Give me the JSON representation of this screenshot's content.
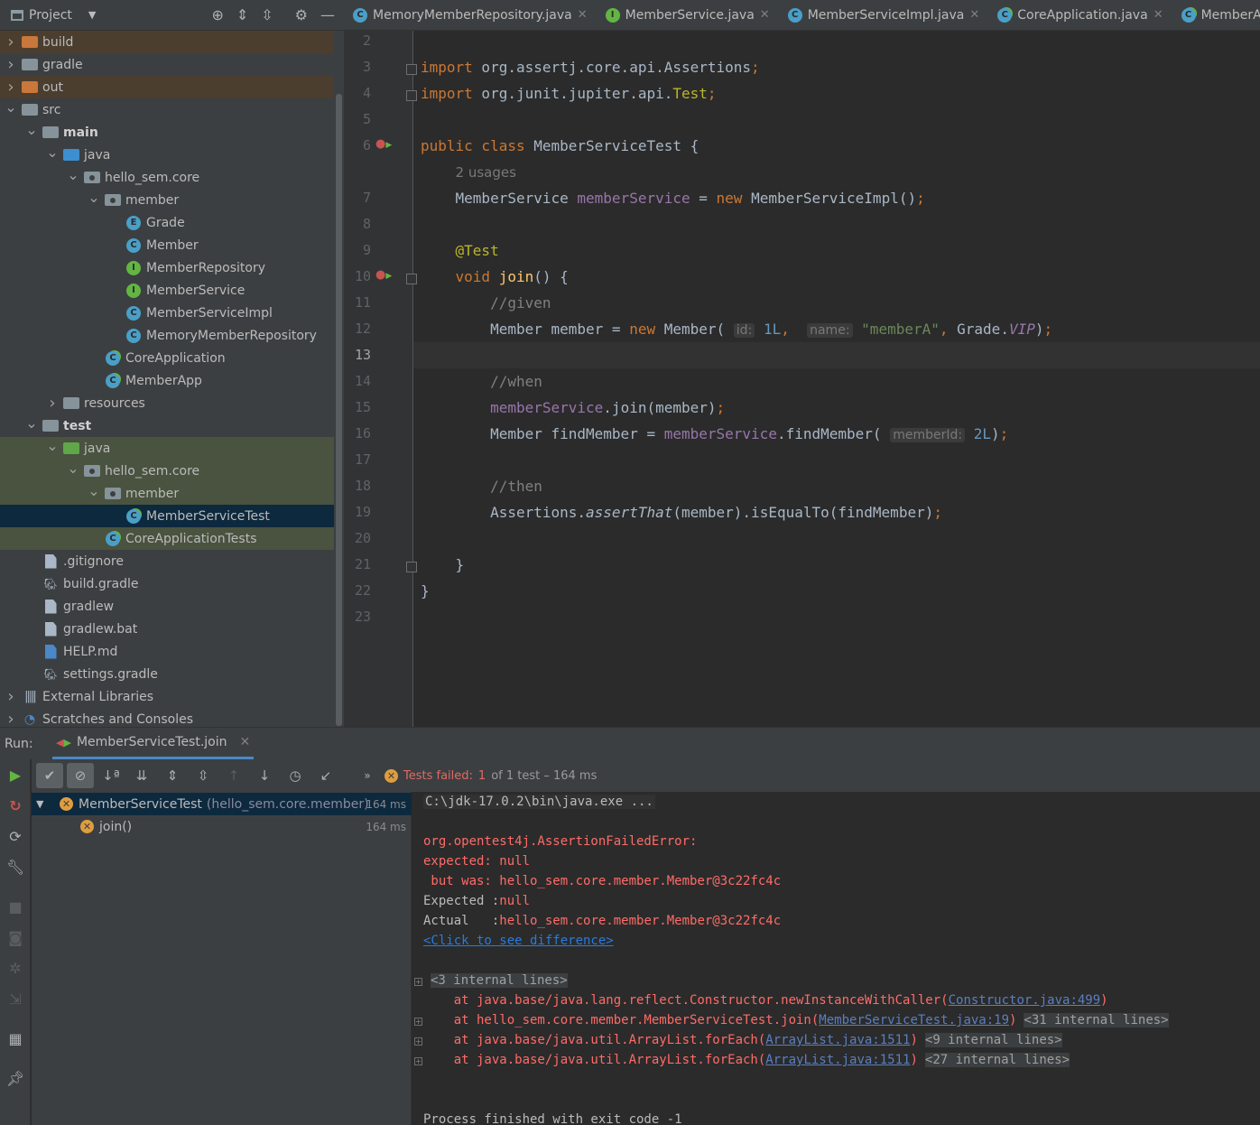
{
  "project_panel": {
    "title": "Project",
    "tree": [
      {
        "label": "build",
        "icon": "folder-orange-icon",
        "arrow": "right",
        "indent": 0,
        "style": "excluded",
        "bold": false
      },
      {
        "label": "gradle",
        "icon": "folder-icon",
        "arrow": "right",
        "indent": 0,
        "style": "",
        "bold": false
      },
      {
        "label": "out",
        "icon": "folder-orange-icon",
        "arrow": "right",
        "indent": 0,
        "style": "excluded",
        "bold": false
      },
      {
        "label": "src",
        "icon": "folder-icon",
        "arrow": "down",
        "indent": 0,
        "style": "",
        "bold": false
      },
      {
        "label": "main",
        "icon": "folder-icon",
        "arrow": "down",
        "indent": 1,
        "style": "",
        "bold": true
      },
      {
        "label": "java",
        "icon": "folder-blue-icon",
        "arrow": "down",
        "indent": 2,
        "style": "",
        "bold": false
      },
      {
        "label": "hello_sem.core",
        "icon": "package-icon",
        "arrow": "down",
        "indent": 3,
        "style": "",
        "bold": false
      },
      {
        "label": "member",
        "icon": "package-icon",
        "arrow": "down",
        "indent": 4,
        "style": "",
        "bold": false
      },
      {
        "label": "Grade",
        "icon": "enum-icon",
        "arrow": "none",
        "indent": 5,
        "style": "",
        "bold": false
      },
      {
        "label": "Member",
        "icon": "class-icon",
        "arrow": "none",
        "indent": 5,
        "style": "",
        "bold": false
      },
      {
        "label": "MemberRepository",
        "icon": "interface-icon",
        "arrow": "none",
        "indent": 5,
        "style": "",
        "bold": false
      },
      {
        "label": "MemberService",
        "icon": "interface-icon",
        "arrow": "none",
        "indent": 5,
        "style": "",
        "bold": false
      },
      {
        "label": "MemberServiceImpl",
        "icon": "class-icon",
        "arrow": "none",
        "indent": 5,
        "style": "",
        "bold": false
      },
      {
        "label": "MemoryMemberRepository",
        "icon": "class-icon",
        "arrow": "none",
        "indent": 5,
        "style": "",
        "bold": false
      },
      {
        "label": "CoreApplication",
        "icon": "runnable-class-icon",
        "arrow": "none",
        "indent": 4,
        "style": "",
        "bold": false
      },
      {
        "label": "MemberApp",
        "icon": "runnable-class-icon",
        "arrow": "none",
        "indent": 4,
        "style": "",
        "bold": false
      },
      {
        "label": "resources",
        "icon": "resources-folder-icon",
        "arrow": "right",
        "indent": 2,
        "style": "",
        "bold": false
      },
      {
        "label": "test",
        "icon": "folder-icon",
        "arrow": "down",
        "indent": 1,
        "style": "",
        "bold": true
      },
      {
        "label": "java",
        "icon": "folder-green-icon",
        "arrow": "down",
        "indent": 2,
        "style": "test",
        "bold": false
      },
      {
        "label": "hello_sem.core",
        "icon": "package-icon",
        "arrow": "down",
        "indent": 3,
        "style": "test",
        "bold": false
      },
      {
        "label": "member",
        "icon": "package-icon",
        "arrow": "down",
        "indent": 4,
        "style": "test",
        "bold": false
      },
      {
        "label": "MemberServiceTest",
        "icon": "runnable-class-icon",
        "arrow": "none",
        "indent": 5,
        "style": "sel",
        "bold": false
      },
      {
        "label": "CoreApplicationTests",
        "icon": "runnable-class-icon",
        "arrow": "none",
        "indent": 4,
        "style": "test",
        "bold": false
      },
      {
        "label": ".gitignore",
        "icon": "file-icon",
        "arrow": "none",
        "indent": 1,
        "style": "",
        "bold": false
      },
      {
        "label": "build.gradle",
        "icon": "gradle-icon",
        "arrow": "none",
        "indent": 1,
        "style": "",
        "bold": false
      },
      {
        "label": "gradlew",
        "icon": "file-icon",
        "arrow": "none",
        "indent": 1,
        "style": "",
        "bold": false
      },
      {
        "label": "gradlew.bat",
        "icon": "file-icon",
        "arrow": "none",
        "indent": 1,
        "style": "",
        "bold": false
      },
      {
        "label": "HELP.md",
        "icon": "markdown-icon",
        "arrow": "none",
        "indent": 1,
        "style": "",
        "bold": false
      },
      {
        "label": "settings.gradle",
        "icon": "gradle-icon",
        "arrow": "none",
        "indent": 1,
        "style": "",
        "bold": false
      },
      {
        "label": "External Libraries",
        "icon": "libraries-icon",
        "arrow": "right",
        "indent": 0,
        "style": "",
        "bold": false
      },
      {
        "label": "Scratches and Consoles",
        "icon": "scratches-icon",
        "arrow": "right",
        "indent": 0,
        "style": "",
        "bold": false
      }
    ]
  },
  "editor_tabs": [
    {
      "label": "MemoryMemberRepository.java",
      "icon": "class-icon",
      "active": false
    },
    {
      "label": "MemberService.java",
      "icon": "interface-icon",
      "active": false
    },
    {
      "label": "MemberServiceImpl.java",
      "icon": "class-icon",
      "active": false
    },
    {
      "label": "CoreApplication.java",
      "icon": "runnable-class-icon",
      "active": false
    },
    {
      "label": "MemberApp.java",
      "icon": "runnable-class-icon",
      "active": false
    }
  ],
  "editor": {
    "current_line": "13",
    "lines": [
      {
        "n": "2",
        "html": ""
      },
      {
        "n": "3",
        "html": "<span class='kw'>import</span> org.assertj.core.api.Assertions<span class='kw'>;</span>"
      },
      {
        "n": "4",
        "html": "<span class='kw'>import</span> org.junit.jupiter.api.<span class='ann'>Test</span><span class='kw'>;</span>"
      },
      {
        "n": "5",
        "html": ""
      },
      {
        "n": "6",
        "html": "<span class='kw'>public class</span> MemberServiceTest {"
      },
      {
        "n": "",
        "html": "    <span class='usages'>2 usages</span>"
      },
      {
        "n": "7",
        "html": "    MemberService <span class='fld'>memberService</span> = <span class='kw'>new</span> MemberServiceImpl()<span class='kw'>;</span>"
      },
      {
        "n": "8",
        "html": ""
      },
      {
        "n": "9",
        "html": "    <span class='ann'>@Test</span>"
      },
      {
        "n": "10",
        "html": "    <span class='kw'>void</span> <span class='fn'>join</span>() {"
      },
      {
        "n": "11",
        "html": "        <span class='cmt'>//given</span>"
      },
      {
        "n": "12",
        "html": "        Member member = <span class='kw'>new</span> Member( <span class='hint'>id:</span> <span class='num'>1L</span><span class='kw'>,</span>  <span class='hint'>name:</span> <span class='str'>\"memberA\"</span><span class='kw'>,</span> Grade.<span class='fld ital'>VIP</span>)<span class='kw'>;</span>"
      },
      {
        "n": "13",
        "html": ""
      },
      {
        "n": "14",
        "html": "        <span class='cmt'>//when</span>"
      },
      {
        "n": "15",
        "html": "        <span class='fld'>memberService</span>.join(member)<span class='kw'>;</span>"
      },
      {
        "n": "16",
        "html": "        Member findMember = <span class='fld'>memberService</span>.findMember( <span class='hint'>memberId:</span> <span class='num'>2L</span>)<span class='kw'>;</span>"
      },
      {
        "n": "17",
        "html": ""
      },
      {
        "n": "18",
        "html": "        <span class='cmt'>//then</span>"
      },
      {
        "n": "19",
        "html": "        Assertions.<span class='ital'>assertThat</span>(member).isEqualTo(findMember)<span class='kw'>;</span>"
      },
      {
        "n": "20",
        "html": ""
      },
      {
        "n": "21",
        "html": "    }"
      },
      {
        "n": "22",
        "html": "}"
      },
      {
        "n": "23",
        "html": ""
      }
    ]
  },
  "run_panel": {
    "label": "Run:",
    "tab_label": "MemberServiceTest.join",
    "status_failed": "Tests failed:",
    "status_count": "1",
    "status_rest": "of 1 test – 164 ms",
    "tests": [
      {
        "name": "MemberServiceTest",
        "pkg": "(hello_sem.core.member)",
        "time": "164 ms"
      },
      {
        "name": "join()",
        "pkg": "",
        "time": "164 ms"
      }
    ],
    "console": [
      {
        "text": "C:\\jdk-17.0.2\\bin\\java.exe ...",
        "cls": "",
        "style": "cmd"
      },
      {
        "text": "",
        "cls": ""
      },
      {
        "text": "org.opentest4j.AssertionFailedError:",
        "cls": "err"
      },
      {
        "text": "expected: null",
        "cls": "err"
      },
      {
        "text": " but was: hello_sem.core.member.Member@3c22fc4c",
        "cls": "err"
      },
      {
        "text": "Expected :null",
        "cls": "mixed1"
      },
      {
        "text": "Actual   :hello_sem.core.member.Member@3c22fc4c",
        "cls": "mixed2"
      },
      {
        "text": "<Click to see difference>",
        "cls": "link"
      },
      {
        "text": "",
        "cls": ""
      },
      {
        "text": "<3 internal lines>",
        "cls": "ilines"
      },
      {
        "text": "    at java.base/java.lang.reflect.Constructor.newInstanceWithCaller(",
        "link": "Constructor.java:499",
        "tail": ")",
        "extra": "",
        "cls": "trace"
      },
      {
        "text": "    at hello_sem.core.member.MemberServiceTest.join(",
        "link": "MemberServiceTest.java:19",
        "tail": ")",
        "extra": "<31 internal lines>",
        "cls": "trace"
      },
      {
        "text": "    at java.base/java.util.ArrayList.forEach(",
        "link": "ArrayList.java:1511",
        "tail": ")",
        "extra": "<9 internal lines>",
        "cls": "trace"
      },
      {
        "text": "    at java.base/java.util.ArrayList.forEach(",
        "link": "ArrayList.java:1511",
        "tail": ")",
        "extra": "<27 internal lines>",
        "cls": "trace"
      },
      {
        "text": "",
        "cls": ""
      },
      {
        "text": "",
        "cls": ""
      },
      {
        "text": "Process finished with exit code -1",
        "cls": ""
      }
    ]
  }
}
